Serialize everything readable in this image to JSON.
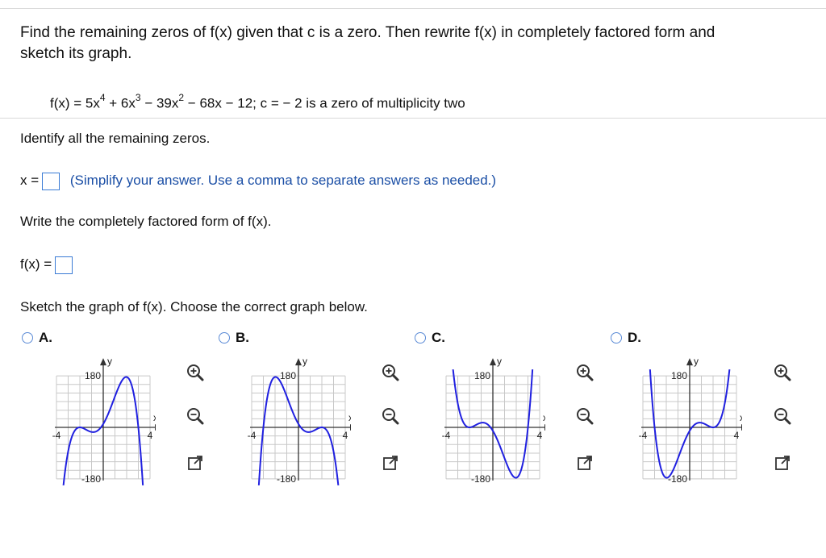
{
  "question": {
    "line1": "Find the remaining zeros of f(x) given that c is a zero. Then rewrite f(x) in completely factored form and",
    "line2": "sketch its graph.",
    "fx_prefix": "f(x) = 5x",
    "exp4": "4",
    "term2": " + 6x",
    "exp3": "3",
    "term3": " − 39x",
    "exp2": "2",
    "term4": " − 68x − 12; c = − 2 is a zero of multiplicity two"
  },
  "part1": {
    "prompt": "Identify all the remaining zeros.",
    "label": "x =",
    "hint": "(Simplify your answer. Use a comma to separate answers as needed.)",
    "value": ""
  },
  "part2": {
    "prompt": "Write the completely factored form of f(x).",
    "label": "f(x) =",
    "value": ""
  },
  "part3": {
    "prompt": "Sketch the graph of f(x). Choose the correct graph below."
  },
  "options": [
    {
      "label": "A."
    },
    {
      "label": "B."
    },
    {
      "label": "C."
    },
    {
      "label": "D."
    }
  ],
  "graph_labels": {
    "y": "y",
    "x": "x",
    "ytop": "180",
    "ybot": "-180",
    "xleft": "-4",
    "xright": "4"
  },
  "icons": {
    "zoom_in": "zoom-in-icon",
    "zoom_out": "zoom-out-icon",
    "popout": "popout-icon"
  },
  "colors": {
    "curve": "#2020e0",
    "accent": "#3a7bd5",
    "hint": "#1a4ea5"
  }
}
